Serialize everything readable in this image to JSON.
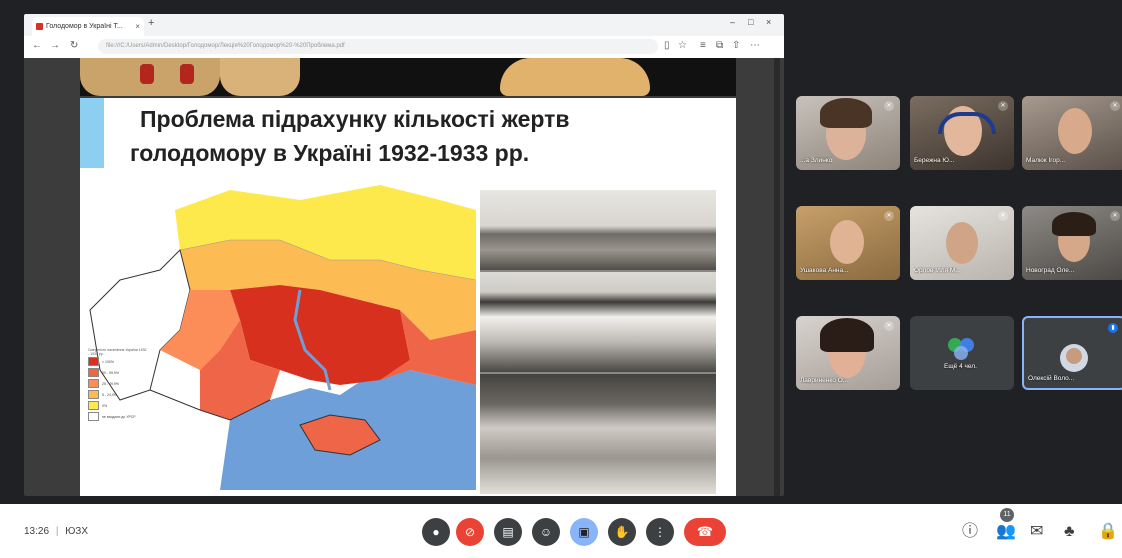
{
  "browser": {
    "tab_title": "Голодомор в Україні Т...",
    "tab_close": "×",
    "new_tab": "+",
    "url": "file:///C:/Users/Admin/Desktop/Голодомор/Лекція%20Голодомор%20-%20Проблема.pdf",
    "window_controls": [
      "–",
      "□",
      "×"
    ]
  },
  "slide": {
    "title_line1": "Проблема підрахунку кількості жертв",
    "title_line2": "голодомору в Україні 1932-1933 рр.",
    "legend_title": "Смертність населення України 1932 - 1933 рр.",
    "legend": [
      {
        "label": "> 100%",
        "color": "#d7301f"
      },
      {
        "label": "50 - 99,9%",
        "color": "#ef6548"
      },
      {
        "label": "25 - 49,9%",
        "color": "#fc8d59"
      },
      {
        "label": "5 - 24,9%",
        "color": "#fdbb54"
      },
      {
        "label": "0%",
        "color": "#fee94c"
      },
      {
        "label": "не входили до УРСР",
        "color": "#ffffff"
      }
    ]
  },
  "participants": [
    {
      "name": "...а Злинко",
      "mic": "muted"
    },
    {
      "name": "Бережна Ю...",
      "mic": "muted"
    },
    {
      "name": "Малюк Ігор...",
      "mic": "muted"
    },
    {
      "name": "Ушакова Анна...",
      "mic": "muted"
    },
    {
      "name": "Орлов Ілля М...",
      "mic": "muted"
    },
    {
      "name": "Новоград Оле...",
      "mic": "muted"
    },
    {
      "name": "Лавриненко О...",
      "mic": "muted"
    },
    {
      "name": "Ещё 4 чел.",
      "mic": "none"
    },
    {
      "name": "Олексій Воло...",
      "mic": "speaking"
    }
  ],
  "bottom_bar": {
    "time": "13:26",
    "separator": "|",
    "meeting_code": "ЮЗХ",
    "people_count": "11"
  },
  "icons": {
    "mic": "mic-icon",
    "camera_off": "camera-off-icon",
    "captions": "captions-icon",
    "emoji": "emoji-icon",
    "present": "present-icon",
    "hand": "raise-hand-icon",
    "more": "more-options-icon",
    "hangup": "hangup-icon",
    "info": "info-icon",
    "people": "people-icon",
    "chat": "chat-icon",
    "activities": "activities-icon",
    "lock": "host-controls-icon"
  },
  "colors": {
    "meet_bg": "#202124",
    "accent_blue": "#8ab4f8",
    "hangup_red": "#ea4335",
    "speaking_badge": "#1a73e8"
  }
}
